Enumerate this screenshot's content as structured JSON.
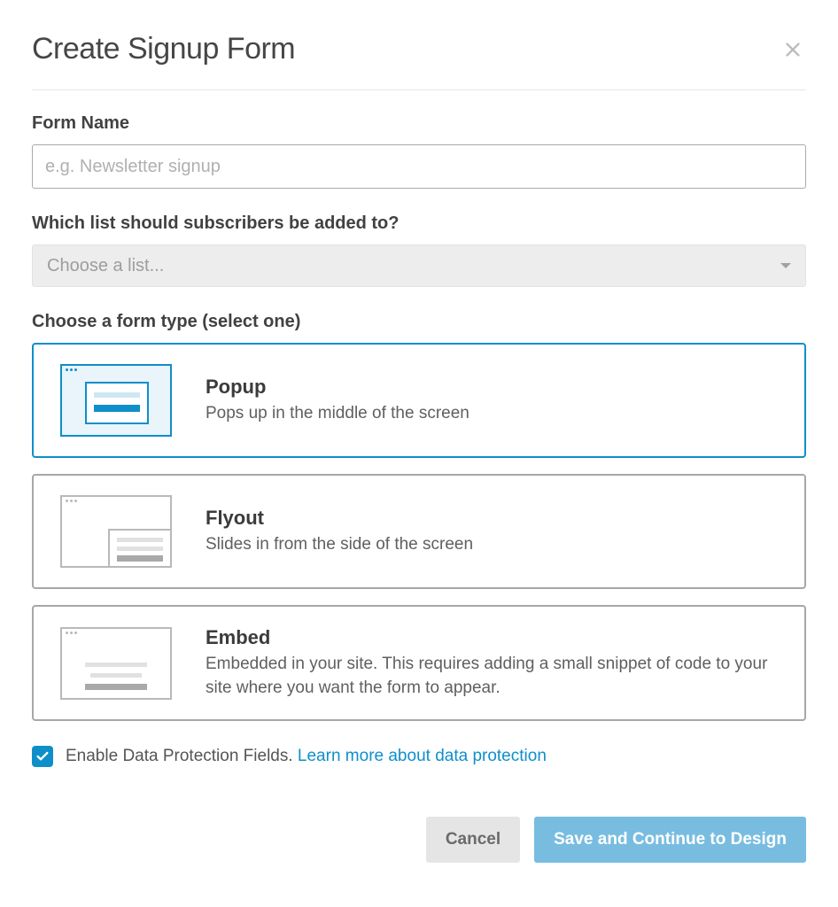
{
  "header": {
    "title": "Create Signup Form"
  },
  "formName": {
    "label": "Form Name",
    "placeholder": "e.g. Newsletter signup",
    "value": ""
  },
  "listSelect": {
    "label": "Which list should subscribers be added to?",
    "placeholder": "Choose a list..."
  },
  "formType": {
    "label": "Choose a form type (select one)",
    "options": [
      {
        "id": "popup",
        "title": "Popup",
        "desc": "Pops up in the middle of the screen",
        "selected": true
      },
      {
        "id": "flyout",
        "title": "Flyout",
        "desc": "Slides in from the side of the screen",
        "selected": false
      },
      {
        "id": "embed",
        "title": "Embed",
        "desc": "Embedded in your site. This requires adding a small snippet of code to your site where you want the form to appear.",
        "selected": false
      }
    ]
  },
  "dataProtection": {
    "checked": true,
    "label": "Enable Data Protection Fields.",
    "linkText": "Learn more about data protection"
  },
  "footer": {
    "cancel": "Cancel",
    "save": "Save and Continue to Design"
  }
}
